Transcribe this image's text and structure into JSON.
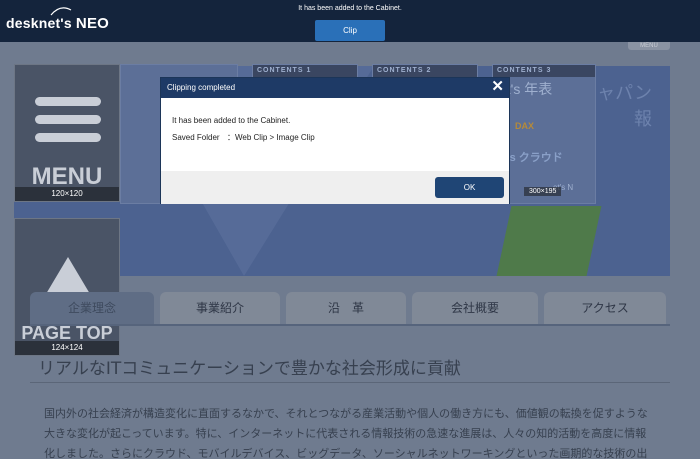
{
  "app": {
    "logo_text": "desknet's",
    "logo_suffix": "NEO",
    "notice": "It has been added to the Cabinet.",
    "clip_button": "Clip"
  },
  "site": {
    "menu_tag": "MENU",
    "menu_button": {
      "label": "MENU",
      "size": "120×120"
    },
    "pagetop_button": {
      "label": "PAGE TOP",
      "size": "124×124"
    },
    "thumbnails": [
      {
        "caption": "",
        "size": ""
      },
      {
        "caption": "CONTENTS 1",
        "size": ""
      },
      {
        "caption": "CONTENTS 2",
        "size": ""
      },
      {
        "caption": "CONTENTS 3",
        "size": "300×195"
      }
    ],
    "thumb3_text": [
      "et's 年表",
      "DAX",
      "'s クラウド",
      "et's N"
    ],
    "hero_text": [
      "ャパン",
      "報"
    ],
    "tabs": [
      "企業理念",
      "事業紹介",
      "沿　革",
      "会社概要",
      "アクセス"
    ],
    "active_tab": 0,
    "heading": "リアルなITコミュニケーションで豊かな社会形成に貢献",
    "paragraph": [
      "国内外の社会経済が構造変化に直面するなかで、それとつながる産業活動や個人の働き方にも、価値観の転換を促すような",
      "大きな変化が起こっています。特に、インターネットに代表される情報技術の急速な進展は、人々の知的活動を高度に情報",
      "化しました。さらにクラウド、モバイルデバイス、ビッグデータ、ソーシャルネットワーキングといった画期的な技術の出"
    ]
  },
  "dialog": {
    "title": "Clipping completed",
    "message": "It has been added to the Cabinet.",
    "folder_label": "Saved Folder",
    "folder_value": "：Web Clip > Image Clip",
    "ok_button": "OK",
    "close_symbol": "✕"
  },
  "colors": {
    "topbar": "#14243c",
    "clip_button": "#2a70b8",
    "dialog_header": "#1e3a66",
    "ok_button": "#1f4575"
  }
}
